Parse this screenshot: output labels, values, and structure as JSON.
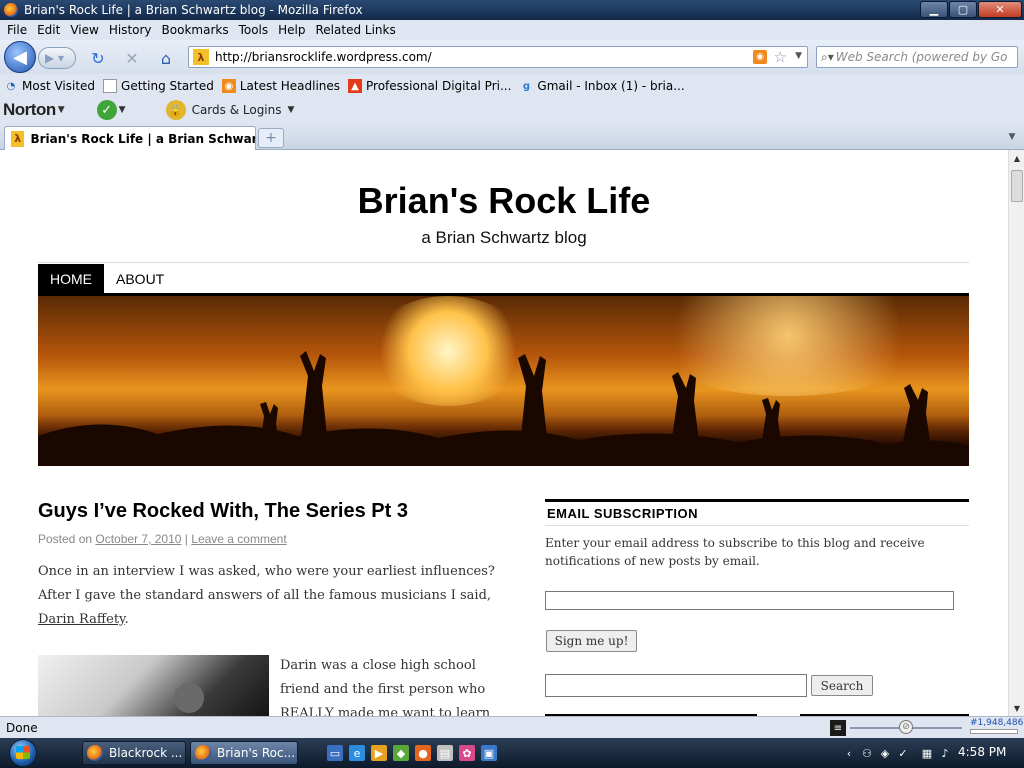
{
  "window": {
    "title": "Brian's Rock Life | a Brian Schwartz blog - Mozilla Firefox"
  },
  "menu": [
    "File",
    "Edit",
    "View",
    "History",
    "Bookmarks",
    "Tools",
    "Help",
    "Related Links"
  ],
  "nav": {
    "url": "http://briansrocklife.wordpress.com/",
    "search_placeholder": "Web Search (powered by Go"
  },
  "bookmarks": [
    {
      "label": "Most Visited",
      "icon": "most-visited-icon"
    },
    {
      "label": "Getting Started",
      "icon": "page-icon"
    },
    {
      "label": "Latest Headlines",
      "icon": "rss-icon"
    },
    {
      "label": "Professional Digital Pri...",
      "icon": "bookmark-site-icon"
    },
    {
      "label": "Gmail - Inbox (1) - bria...",
      "icon": "google-icon"
    }
  ],
  "norton": {
    "logo": "Norton",
    "cards": "Cards & Logins"
  },
  "tab": {
    "title": "Brian's Rock Life | a Brian Schwartz b..."
  },
  "site": {
    "title": "Brian's Rock Life",
    "description": "a Brian Schwartz blog",
    "menu": [
      "HOME",
      "ABOUT"
    ]
  },
  "post": {
    "title": "Guys I’ve Rocked With, The Series Pt 3",
    "meta_prefix": "Posted on",
    "date": "October 7, 2010",
    "separator": "|",
    "comment_link": "Leave a comment",
    "p1_text": "Once in an interview I was asked, who were your earliest influences?  After I gave the standard answers of all the famous musicians I said, ",
    "p1_link": "Darin Raffety",
    "p1_end": ".",
    "p2": "Darin was a close high school friend and the first person who REALLY made me want to learn how to play"
  },
  "widget": {
    "title": "EMAIL SUBSCRIPTION",
    "text": "Enter your email address to subscribe to this blog and receive notifications of new posts by email.",
    "signup_label": "Sign me up!",
    "search_label": "Search"
  },
  "status": {
    "text": "Done",
    "rank": "#1,948,486"
  },
  "taskbar": {
    "tasks": [
      "Blackrock ...",
      "Brian's Roc..."
    ],
    "clock": "4:58 PM"
  },
  "colors": {
    "accent": "#000000",
    "link": "#888888",
    "banner": "#e8951f"
  }
}
